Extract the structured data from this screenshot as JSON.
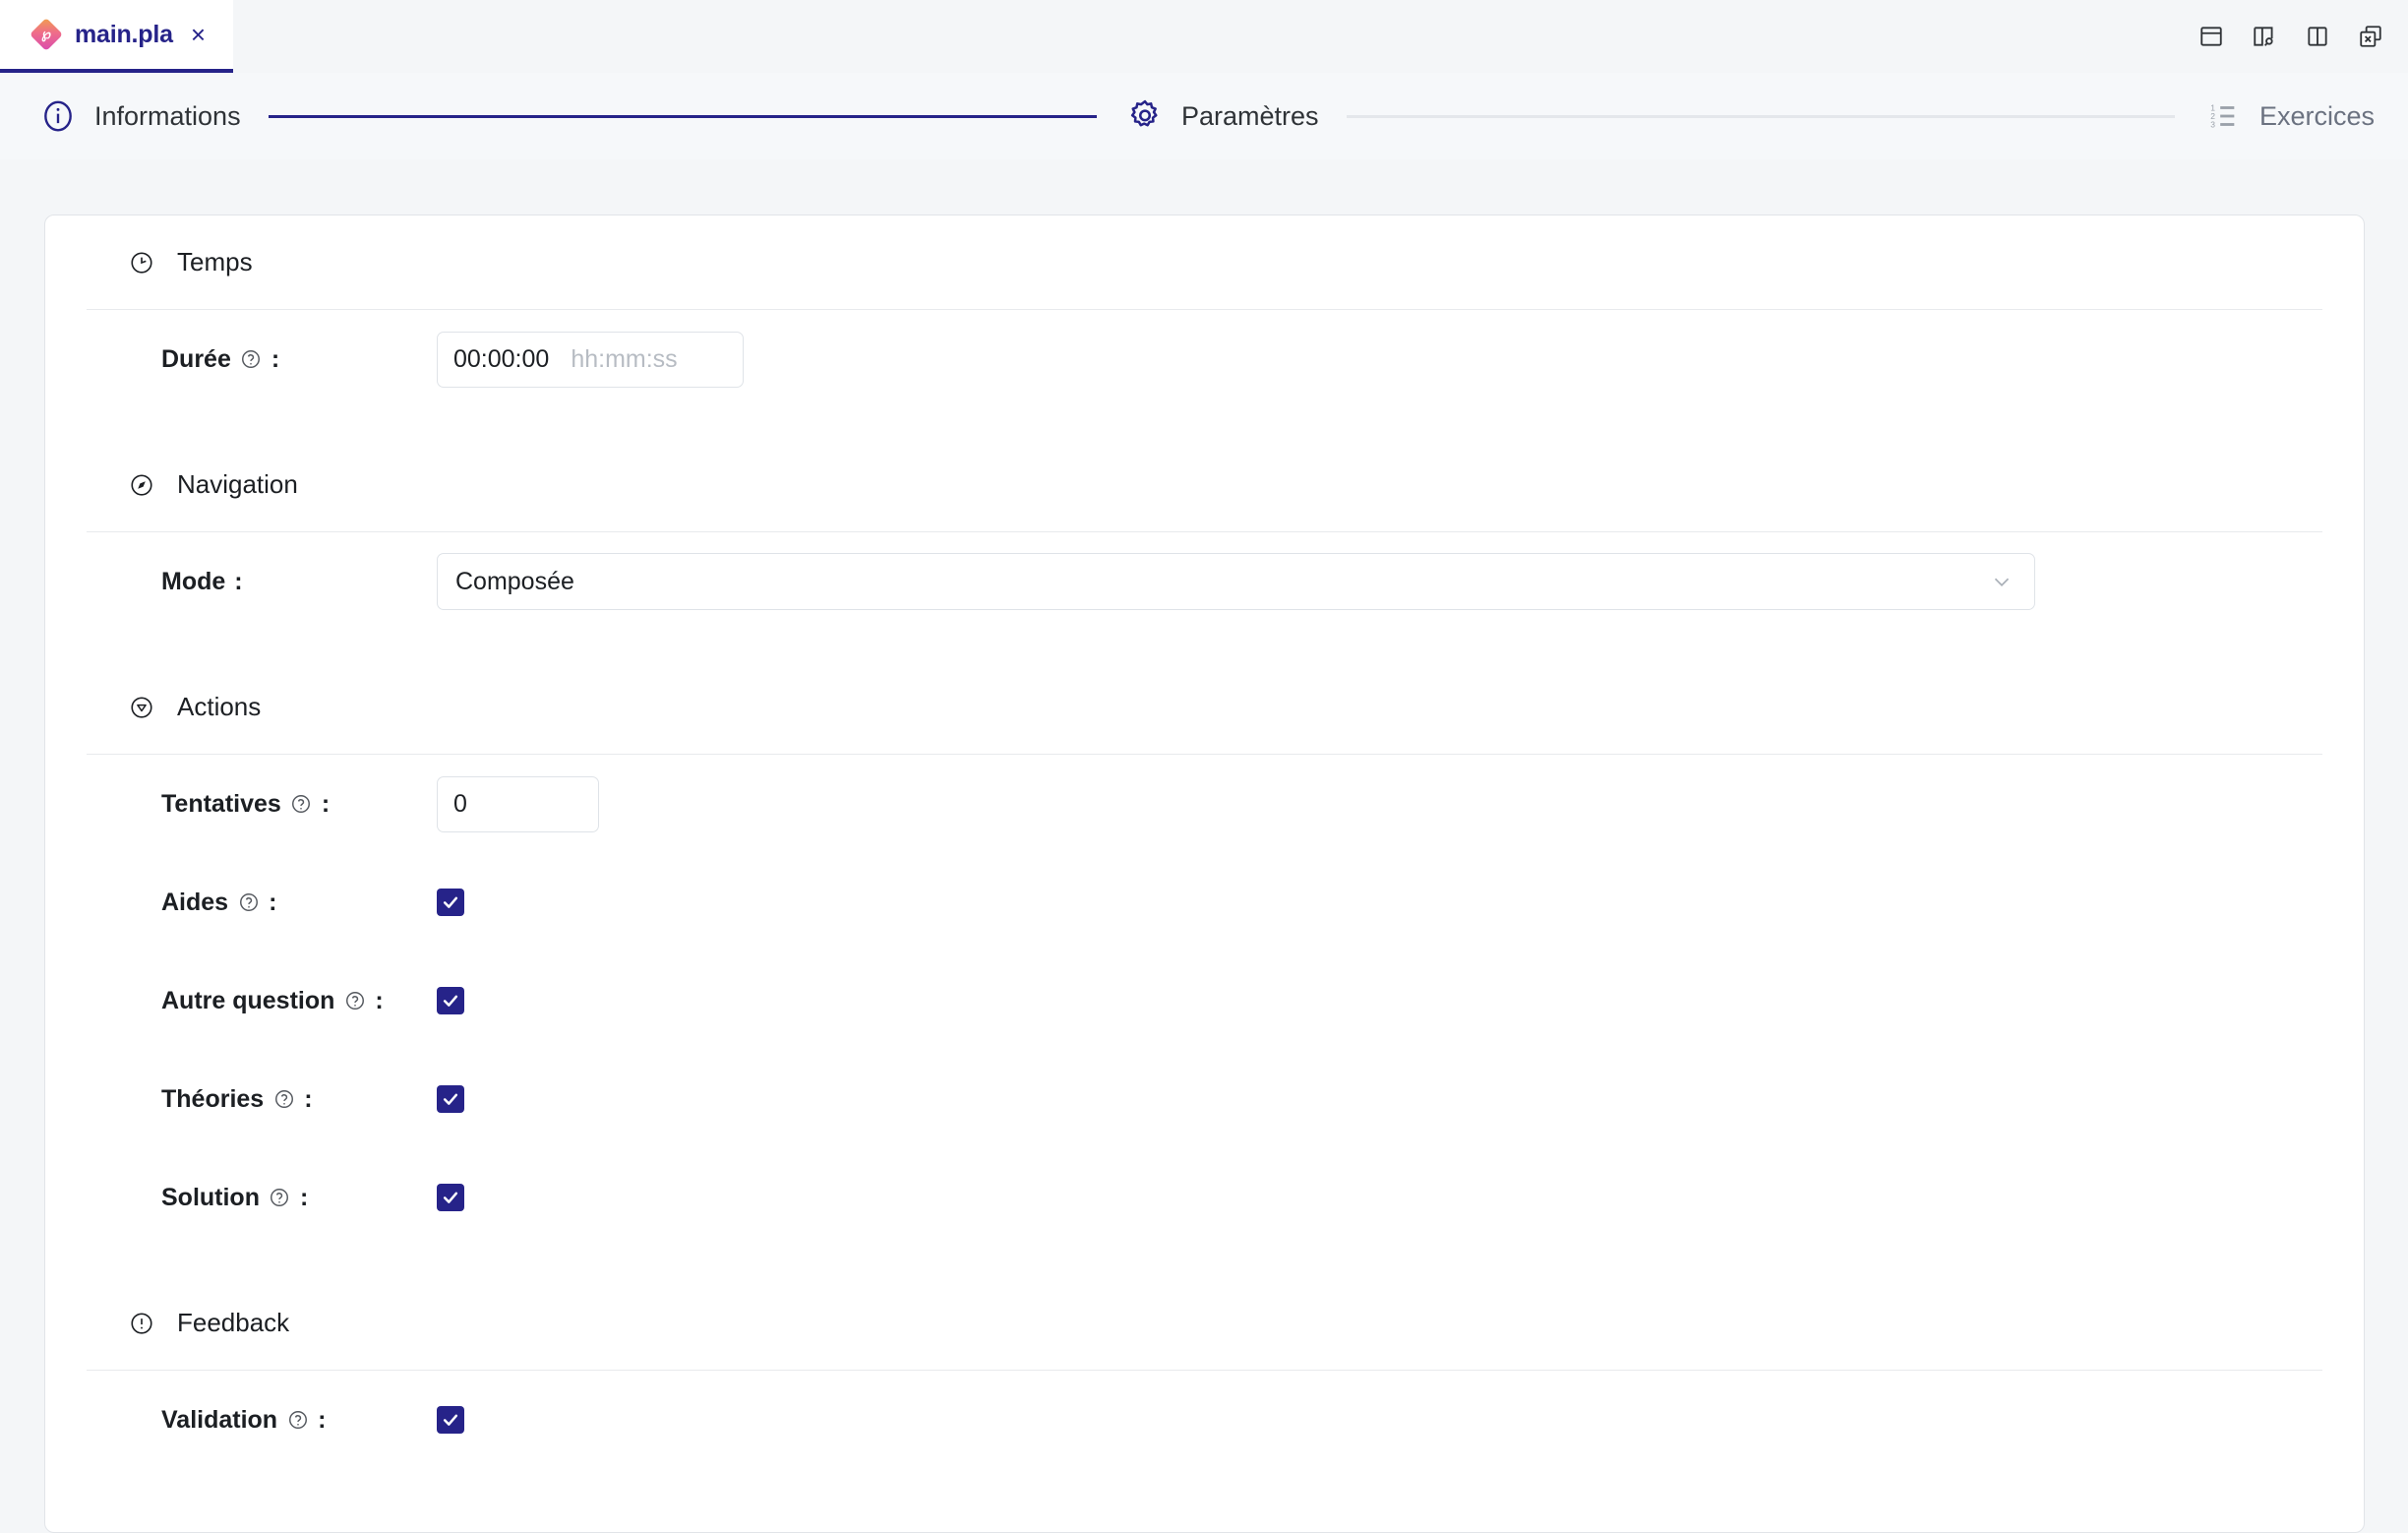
{
  "tab": {
    "title": "main.pla",
    "close_label": "×",
    "logo_glyph": "℘"
  },
  "window_tools": [
    {
      "name": "layout-horizontal-split-icon",
      "title": "Horizontal split"
    },
    {
      "name": "panel-inspect-icon",
      "title": "Inspect panel"
    },
    {
      "name": "layout-vertical-split-icon",
      "title": "Vertical split"
    },
    {
      "name": "detach-close-panel-icon",
      "title": "Detach panel"
    }
  ],
  "stepper": {
    "steps": [
      {
        "label": "Informations",
        "icon": "info-circle-icon",
        "state": "done"
      },
      {
        "label": "Paramètres",
        "icon": "gear-icon",
        "state": "active"
      },
      {
        "label": "Exercices",
        "icon": "ordered-list-icon",
        "state": "inactive"
      }
    ],
    "connectors": [
      "done",
      "todo"
    ]
  },
  "sections": [
    {
      "id": "temps",
      "title": "Temps",
      "icon": "clock-icon",
      "rows": [
        {
          "id": "duree",
          "label": "Durée",
          "colon": ":",
          "type": "text",
          "value": "00:00:00",
          "placeholder": "hh:mm:ss"
        }
      ]
    },
    {
      "id": "navigation",
      "title": "Navigation",
      "icon": "compass-icon",
      "rows": [
        {
          "id": "mode",
          "label": "Mode",
          "colon": ":",
          "type": "select",
          "value": "Composée"
        }
      ]
    },
    {
      "id": "actions",
      "title": "Actions",
      "icon": "caret-down-circle-icon",
      "rows": [
        {
          "id": "tentatives",
          "label": "Tentatives",
          "colon": ":",
          "type": "number",
          "value": "0"
        },
        {
          "id": "aides",
          "label": "Aides",
          "colon": ":",
          "type": "checkbox",
          "checked": true
        },
        {
          "id": "autre-question",
          "label": "Autre question",
          "colon": ":",
          "type": "checkbox",
          "checked": true
        },
        {
          "id": "theories",
          "label": "Théories",
          "colon": ":",
          "type": "checkbox",
          "checked": true
        },
        {
          "id": "solution",
          "label": "Solution",
          "colon": ":",
          "type": "checkbox",
          "checked": true
        }
      ]
    },
    {
      "id": "feedback",
      "title": "Feedback",
      "icon": "alert-circle-icon",
      "rows": [
        {
          "id": "validation",
          "label": "Validation",
          "colon": ":",
          "type": "checkbox",
          "checked": true
        }
      ]
    }
  ],
  "colors": {
    "accent": "#262389",
    "page_bg": "#f4f6f8",
    "card_bg": "#ffffff",
    "border": "#e1e4e8",
    "muted_text": "#6b7280",
    "placeholder": "#b7bcc3"
  }
}
